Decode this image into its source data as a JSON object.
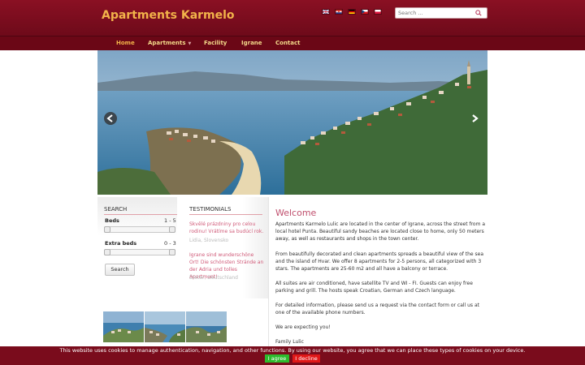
{
  "header": {
    "brand": "Apartments Karmelo",
    "search_placeholder": "Search ...",
    "languages": [
      "english-flag",
      "croatian-flag",
      "german-flag",
      "czech-flag",
      "polish-flag"
    ]
  },
  "nav": {
    "items": [
      {
        "label": "Home"
      },
      {
        "label": "Apartments"
      },
      {
        "label": "Facility"
      },
      {
        "label": "Igrane"
      },
      {
        "label": "Contact"
      }
    ]
  },
  "search": {
    "title": "SEARCH",
    "beds_label": "Beds",
    "beds_range": "1 - 5",
    "extra_label": "Extra beds",
    "extra_range": "0 - 3",
    "button": "Search"
  },
  "testimonials": {
    "title": "TESTIMONIALS",
    "items": [
      {
        "text": "Skvělé prázdniny pro celou rodinu! Vrátíme sa budúcí rok.",
        "author": "Lidia, Slovensko"
      },
      {
        "text": "Igrane sind wunderschöne Ort! Die schönsten Strände an der Adria und tolles Apartment!",
        "author": "Dieter, Deutschland"
      }
    ]
  },
  "main": {
    "title": "Welcome",
    "paragraphs": [
      "Apartments Karmelo Lulic are located in the center of Igrane, across the street from a local hotel Punta. Beautiful sandy beaches are located close to home, only 50 meters away, as well as restaurants and shops in the town center.",
      "From beautifully decorated and clean apartments spreads a beautiful view of the sea and the island of Hvar. We offer 8 apartments for 2-5 persons, all categorized with 3 stars. The apartments are 25-60 m2 and all have a balcony or terrace.",
      "All suites are air conditioned, have satellite TV and WI - FI. Guests can enjoy free parking and grill. The hosts speak Croatian, German and Czech language.",
      "For detailed information, please send us a request via the contact form or call us at one of the available phone numbers.",
      "We are expecting you!",
      "Family Lulic"
    ]
  },
  "cookie": {
    "text": "This website uses cookies to manage authentication, navigation, and other functions. By using our website, you agree that we can place these types of cookies on your device.",
    "agree": "I agree",
    "decline": "I decline"
  },
  "colors": {
    "header": "#7a0c1c",
    "brand": "#f2b34a",
    "accent": "#c0506e"
  }
}
